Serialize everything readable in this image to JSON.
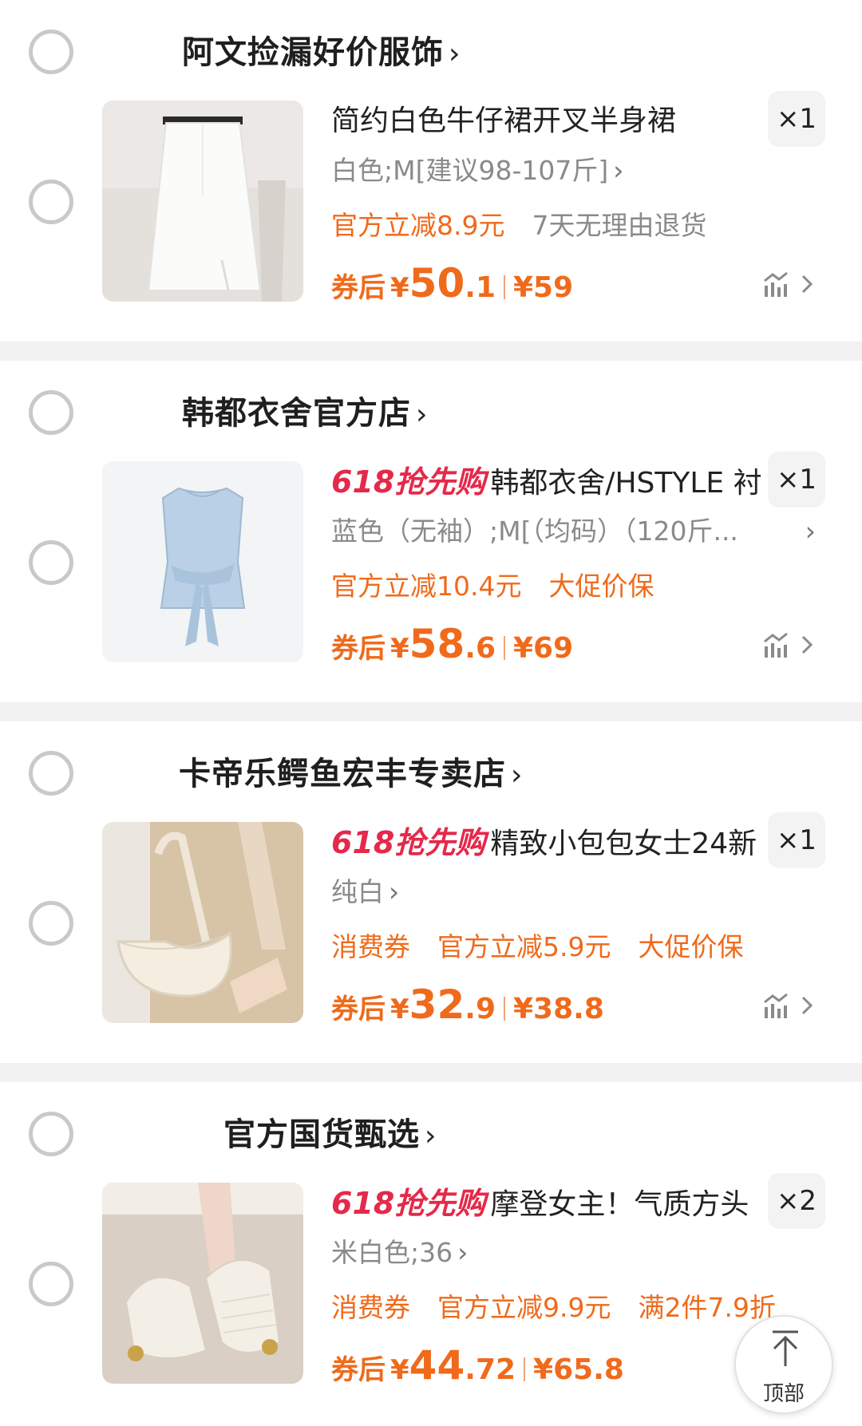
{
  "colors": {
    "accent_orange": "#f06a1b",
    "promo_red": "#e5294a",
    "muted_text": "#8a8a8a",
    "checkbox_border": "#c9c9c9"
  },
  "cart": [
    {
      "store": "阿文捡漏好价服饰",
      "store_chevron": "›",
      "promo_tag": "",
      "title": "简约白色牛仔裙开叉半身裙",
      "quantity": "×1",
      "spec": "白色;M[建议98-107斤]",
      "spec_chevron": "›",
      "tags": [
        {
          "text": "官方立减8.9元",
          "style": "orange"
        },
        {
          "text": "7天无理由退货",
          "style": "grey"
        }
      ],
      "price_label": "券后",
      "currency": "¥",
      "price_int": "50",
      "price_dec": ".1",
      "original_price": "¥59",
      "thumb_icon": "white-denim-skirt"
    },
    {
      "store": "韩都衣舍官方店",
      "store_chevron": "›",
      "promo_tag": "618抢先购",
      "title": "韩都衣舍/HSTYLE 衬",
      "quantity": "×1",
      "spec": "蓝色（无袖）;M[（均码）（120斤...",
      "spec_chevron": "›",
      "tags": [
        {
          "text": "官方立减10.4元",
          "style": "orange"
        },
        {
          "text": "大促价保",
          "style": "orange"
        }
      ],
      "price_label": "券后",
      "currency": "¥",
      "price_int": "58",
      "price_dec": ".6",
      "original_price": "¥69",
      "thumb_icon": "blue-sleeveless-top"
    },
    {
      "store": "卡帝乐鳄鱼宏丰专卖店",
      "store_chevron": "›",
      "promo_tag": "618抢先购",
      "title": "精致小包包女士24新",
      "quantity": "×1",
      "spec": "纯白",
      "spec_chevron": "›",
      "tags": [
        {
          "text": "消费券",
          "style": "orange"
        },
        {
          "text": "官方立减5.9元",
          "style": "orange"
        },
        {
          "text": "大促价保",
          "style": "orange"
        }
      ],
      "price_label": "券后",
      "currency": "¥",
      "price_int": "32",
      "price_dec": ".9",
      "original_price": "¥38.8",
      "thumb_icon": "white-shoulder-bag"
    },
    {
      "store": "官方国货甄选",
      "store_chevron": "›",
      "promo_tag": "618抢先购",
      "title": "摩登女主！气质方头",
      "quantity": "×2",
      "spec": "米白色;36",
      "spec_chevron": "›",
      "tags": [
        {
          "text": "消费券",
          "style": "orange"
        },
        {
          "text": "官方立减9.9元",
          "style": "orange"
        },
        {
          "text": "满2件7.9折",
          "style": "orange"
        }
      ],
      "price_label": "券后",
      "currency": "¥",
      "price_int": "44",
      "price_dec": ".72",
      "original_price": "¥65.8",
      "thumb_icon": "cream-slingback-shoes"
    }
  ],
  "top_button": {
    "label": "顶部",
    "icon": "arrow-up-icon"
  }
}
